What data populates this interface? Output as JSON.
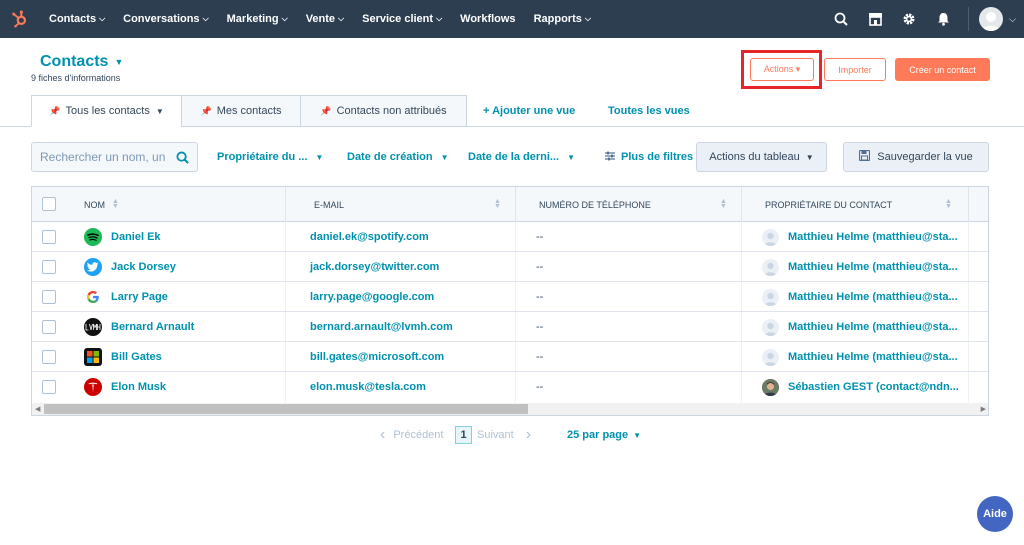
{
  "nav": {
    "items": [
      {
        "label": "Contacts",
        "has_caret": true
      },
      {
        "label": "Conversations",
        "has_caret": true
      },
      {
        "label": "Marketing",
        "has_caret": true
      },
      {
        "label": "Vente",
        "has_caret": true
      },
      {
        "label": "Service client",
        "has_caret": true
      },
      {
        "label": "Workflows",
        "has_caret": false
      },
      {
        "label": "Rapports",
        "has_caret": true
      }
    ],
    "caret": "⌄",
    "right_icons": [
      "search-icon",
      "marketplace-icon",
      "settings-icon",
      "notifications-icon"
    ]
  },
  "header": {
    "title": "Contacts",
    "title_caret": "▼",
    "record_count": "9 fiches d'informations",
    "actions_label": "Actions ▾",
    "import_label": "Importer",
    "create_label": "Créer un contact",
    "highlight_color": "#e5252a"
  },
  "tabs": {
    "all": "Tous les contacts",
    "mine": "Mes contacts",
    "unassigned": "Contacts non attribués",
    "add_view": "+ Ajouter une vue",
    "all_views": "Toutes les vues",
    "caret": "▼"
  },
  "filters": {
    "search_placeholder": "Rechercher un nom, un",
    "owner": "Propriétaire du ...",
    "created": "Date de création",
    "last": "Date de la derni...",
    "more": "Plus de filtres",
    "table_actions": "Actions du tableau",
    "save_view": "Sauvegarder la vue",
    "caret": "▼"
  },
  "table": {
    "columns": [
      "NOM",
      "E-MAIL",
      "NUMÉRO DE TÉLÉPHONE",
      "PROPRIÉTAIRE DU CONTACT"
    ],
    "rows": [
      {
        "name": "Daniel Ek",
        "email": "daniel.ek@spotify.com",
        "phone": "--",
        "owner": "Matthieu Helme (matthieu@sta...",
        "logo": "spotify-logo-icon"
      },
      {
        "name": "Jack Dorsey",
        "email": "jack.dorsey@twitter.com",
        "phone": "--",
        "owner": "Matthieu Helme (matthieu@sta...",
        "logo": "twitter-logo-icon"
      },
      {
        "name": "Larry Page",
        "email": "larry.page@google.com",
        "phone": "--",
        "owner": "Matthieu Helme (matthieu@sta...",
        "logo": "google-logo-icon"
      },
      {
        "name": "Bernard Arnault",
        "email": "bernard.arnault@lvmh.com",
        "phone": "--",
        "owner": "Matthieu Helme (matthieu@sta...",
        "logo": "lvmh-logo-icon"
      },
      {
        "name": "Bill Gates",
        "email": "bill.gates@microsoft.com",
        "phone": "--",
        "owner": "Matthieu Helme (matthieu@sta...",
        "logo": "microsoft-logo-icon"
      },
      {
        "name": "Elon Musk",
        "email": "elon.musk@tesla.com",
        "phone": "--",
        "owner": "Sébastien GEST (contact@ndn...",
        "logo": "tesla-logo-icon"
      }
    ]
  },
  "pagination": {
    "prev": "Précédent",
    "page": "1",
    "next": "Suivant",
    "per_page": "25 par page",
    "caret": "▼"
  },
  "help": {
    "label": "Aide"
  },
  "colors": {
    "nav_bg": "#2d3e50",
    "link": "#0091ae",
    "accent": "#ff7a59",
    "border": "#cbd6e2"
  }
}
